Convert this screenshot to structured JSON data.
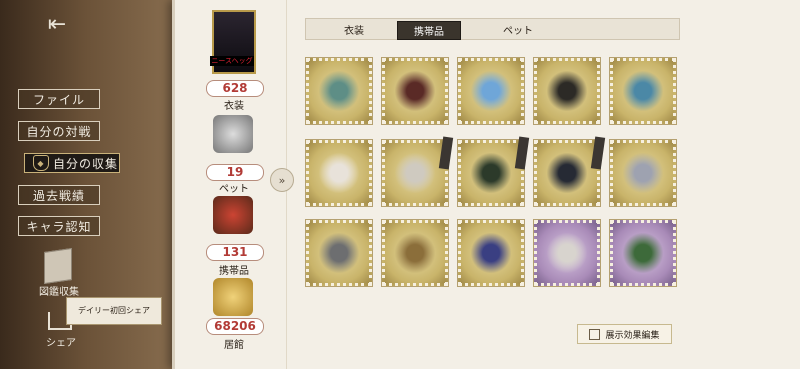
{
  "sidebar": {
    "items": [
      {
        "label": "ファイル"
      },
      {
        "label": "自分の対戦"
      },
      {
        "label": "自分の収集"
      },
      {
        "label": "過去戦績"
      },
      {
        "label": "キャラ認知"
      }
    ],
    "encyclopedia_label": "図鑑収集",
    "share_label": "シェア",
    "daily_bonus_text": "デイリー初回シェア"
  },
  "stats": {
    "portrait_name": "ニースヘッグ",
    "costume": {
      "count": "628",
      "label": "衣装"
    },
    "pet": {
      "count": "19",
      "label": "ペット"
    },
    "accessory": {
      "count": "131",
      "label": "携帯品"
    },
    "residence": {
      "count": "68206",
      "label": "居館"
    }
  },
  "tabs": [
    {
      "label": "衣装",
      "active": false
    },
    {
      "label": "携帯品",
      "active": true
    },
    {
      "label": "ペット",
      "active": false
    }
  ],
  "grid": {
    "items": [
      {
        "name": "staff",
        "frame": "gold",
        "art_color": "#5e8e86"
      },
      {
        "name": "sickle-mushroom",
        "frame": "gold",
        "art_color": "#5a2a26"
      },
      {
        "name": "blue-crystal-flower",
        "frame": "gold",
        "art_color": "#6fa6d8"
      },
      {
        "name": "scythe",
        "frame": "gold",
        "art_color": "#2c2a26"
      },
      {
        "name": "antler-staff",
        "frame": "gold",
        "art_color": "#4b88a6"
      },
      {
        "name": "winged-letter",
        "frame": "gold",
        "art_color": "#e8e2da",
        "ribbon": false
      },
      {
        "name": "chain-whip",
        "frame": "gold",
        "art_color": "#cfcac0",
        "ribbon": true
      },
      {
        "name": "champagne-bottle",
        "frame": "gold",
        "art_color": "#2c3a2a",
        "ribbon": true
      },
      {
        "name": "flip-phone",
        "frame": "gold",
        "art_color": "#262a34",
        "ribbon": true
      },
      {
        "name": "jewel-case",
        "frame": "gold",
        "art_color": "#9ea2b0"
      },
      {
        "name": "winged-helmet",
        "frame": "gold",
        "art_color": "#6d6e70"
      },
      {
        "name": "rose-gear",
        "frame": "gold",
        "art_color": "#8b6e3a"
      },
      {
        "name": "potion-vial",
        "frame": "gold",
        "art_color": "#3a3f82"
      },
      {
        "name": "hat-mask",
        "frame": "purple",
        "art_color": "#d8d4ce"
      },
      {
        "name": "vine-blade",
        "frame": "purple",
        "art_color": "#3d6a3a"
      }
    ]
  },
  "edit_button_label": "展示効果編集",
  "colors": {
    "accent_red": "#b23b36",
    "active_tab": "#3a342c"
  }
}
